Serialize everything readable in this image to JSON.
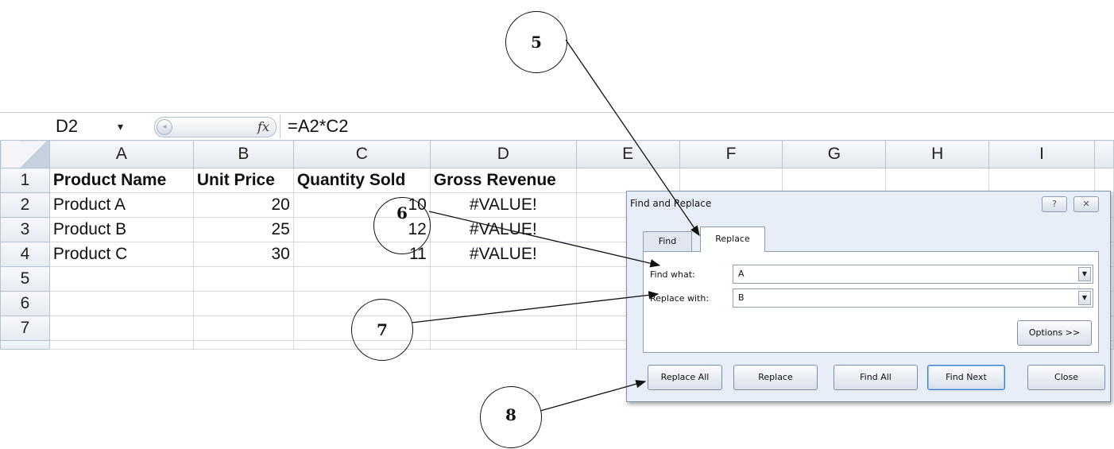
{
  "formula_bar": {
    "name_box": "D2",
    "dropdown_arrow": "▾",
    "fx_label": "fx",
    "formula": "=A2*C2"
  },
  "columns": [
    "A",
    "B",
    "C",
    "D",
    "E",
    "F",
    "G",
    "H",
    "I"
  ],
  "rows": [
    {
      "num": "1",
      "a": "Product Name",
      "b": "Unit Price",
      "c": "Quantity Sold",
      "d": "Gross Revenue"
    },
    {
      "num": "2",
      "a": "Product A",
      "b": "20",
      "c": "10",
      "d": "#VALUE!"
    },
    {
      "num": "3",
      "a": "Product B",
      "b": "25",
      "c": "12",
      "d": "#VALUE!"
    },
    {
      "num": "4",
      "a": "Product C",
      "b": "30",
      "c": "11",
      "d": "#VALUE!"
    },
    {
      "num": "5",
      "a": "",
      "b": "",
      "c": "",
      "d": ""
    },
    {
      "num": "6",
      "a": "",
      "b": "",
      "c": "",
      "d": ""
    },
    {
      "num": "7",
      "a": "",
      "b": "",
      "c": "",
      "d": ""
    }
  ],
  "dialog": {
    "title": "Find and Replace",
    "help_glyph": "?",
    "close_glyph": "✕",
    "tabs": {
      "find": "Find",
      "replace": "Replace"
    },
    "find_what_label": "Find what:",
    "find_what_value": "A",
    "replace_with_label": "Replace with:",
    "replace_with_value": "B",
    "dropdown_glyph": "▼",
    "options_button": "Options >>",
    "buttons": {
      "replace_all": "Replace All",
      "replace": "Replace",
      "find_all": "Find All",
      "find_next": "Find Next",
      "close": "Close"
    }
  },
  "callouts": [
    "5",
    "6",
    "7",
    "8"
  ]
}
